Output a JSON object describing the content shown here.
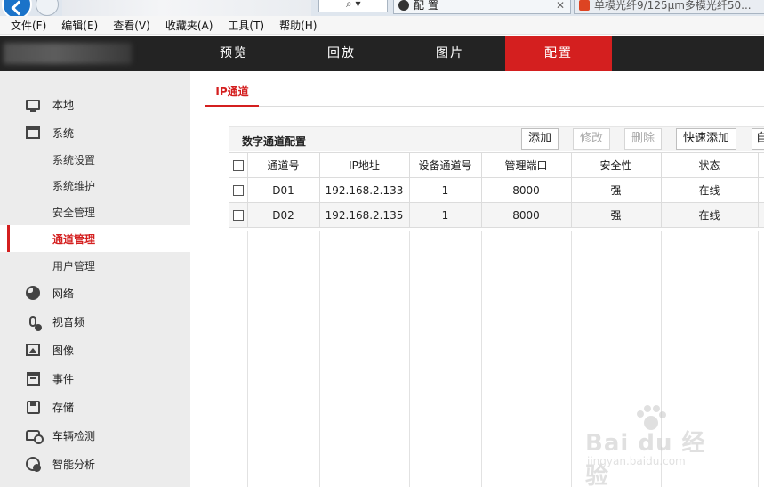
{
  "browser": {
    "tabs": [
      {
        "title": "配 置"
      },
      {
        "title": "单模光纤9/125μm多模光纤50..."
      }
    ]
  },
  "menubar": {
    "items": [
      "文件(F)",
      "编辑(E)",
      "查看(V)",
      "收藏夹(A)",
      "工具(T)",
      "帮助(H)"
    ]
  },
  "header": {
    "tabs": [
      {
        "label": "预览",
        "active": false
      },
      {
        "label": "回放",
        "active": false
      },
      {
        "label": "图片",
        "active": false
      },
      {
        "label": "配置",
        "active": true
      }
    ],
    "active_color": "#d41f1f"
  },
  "sidebar": {
    "items": [
      {
        "label": "本地",
        "icon": "monitor-icon"
      },
      {
        "label": "系统",
        "icon": "window-icon"
      },
      {
        "label": "系统设置",
        "sub": true
      },
      {
        "label": "系统维护",
        "sub": true
      },
      {
        "label": "安全管理",
        "sub": true
      },
      {
        "label": "通道管理",
        "sub": true,
        "active": true
      },
      {
        "label": "用户管理",
        "sub": true
      },
      {
        "label": "网络",
        "icon": "globe-icon"
      },
      {
        "label": "视音频",
        "icon": "microphone-icon"
      },
      {
        "label": "图像",
        "icon": "image-icon"
      },
      {
        "label": "事件",
        "icon": "calendar-icon"
      },
      {
        "label": "存储",
        "icon": "disk-icon"
      },
      {
        "label": "车辆检测",
        "icon": "car-search-icon"
      },
      {
        "label": "智能分析",
        "icon": "smart-analysis-icon"
      }
    ]
  },
  "content": {
    "sub_tab": "IP通道",
    "panel_title": "数字通道配置",
    "buttons": {
      "add": "添加",
      "modify": "修改",
      "delete": "删除",
      "quick_add": "快速添加",
      "auto": "自"
    },
    "table": {
      "headers": [
        "通道号",
        "IP地址",
        "设备通道号",
        "管理端口",
        "安全性",
        "状态"
      ],
      "rows": [
        [
          "D01",
          "192.168.2.133",
          "1",
          "8000",
          "强",
          "在线"
        ],
        [
          "D02",
          "192.168.2.135",
          "1",
          "8000",
          "强",
          "在线"
        ]
      ]
    }
  },
  "watermark": {
    "brand": "Bai du 经验",
    "url": "jingyan.baidu.com"
  }
}
